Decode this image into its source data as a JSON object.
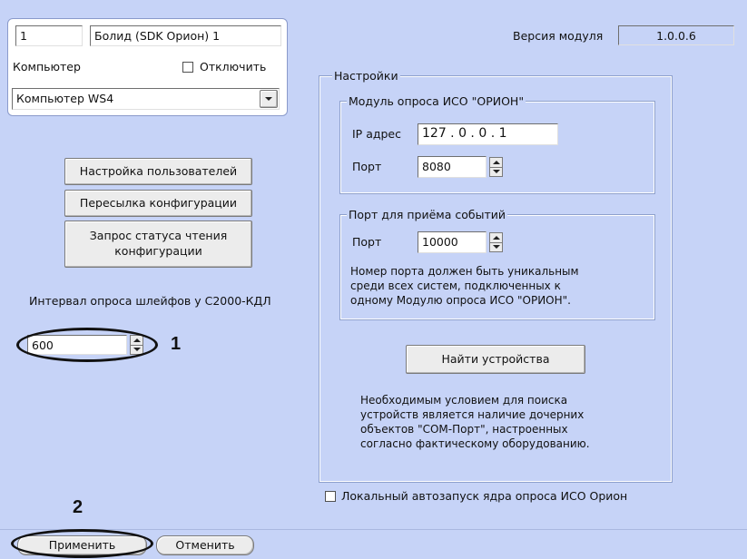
{
  "device": {
    "id_value": "1",
    "name_value": "Болид (SDK Орион) 1",
    "computer_label": "Компьютер",
    "disable_label": "Отключить",
    "computer_value": "Компьютер WS4"
  },
  "actions": {
    "users_settings": "Настройка пользователей",
    "send_config": "Пересылка конфигурации",
    "read_status_line1": "Запрос статуса чтения",
    "read_status_line2": "конфигурации"
  },
  "polling": {
    "label": "Интервал опроса шлейфов у С2000-КДЛ",
    "value": "600"
  },
  "version": {
    "label": "Версия модуля",
    "value": "1.0.0.6"
  },
  "settings": {
    "legend": "Настройки",
    "module_group": {
      "legend": "Модуль опроса ИСО \"ОРИОН\"",
      "ip_label": "IP адрес",
      "ip_value": "127 .  0  .  0  . 1",
      "port_label": "Порт",
      "port_value": "8080"
    },
    "events_group": {
      "legend": "Порт для приёма событий",
      "port_label": "Порт",
      "port_value": "10000",
      "note_line1": "Номер порта должен быть уникальным",
      "note_line2": "среди всех систем, подключенных к",
      "note_line3": "одному Модулю опроса ИСО \"ОРИОН\"."
    },
    "find_button": "Найти устройства",
    "find_note_line1": "Необходимым условием для поиска",
    "find_note_line2": "устройств является наличие дочерних",
    "find_note_line3": "объектов \"COM-Порт\", настроенных",
    "find_note_line4": "согласно фактическому оборудованию."
  },
  "local_autostart_label": "Локальный автозапуск ядра опроса ИСО Орион",
  "footer": {
    "apply": "Применить",
    "cancel": "Отменить"
  },
  "callouts": {
    "one": "1",
    "two": "2"
  }
}
